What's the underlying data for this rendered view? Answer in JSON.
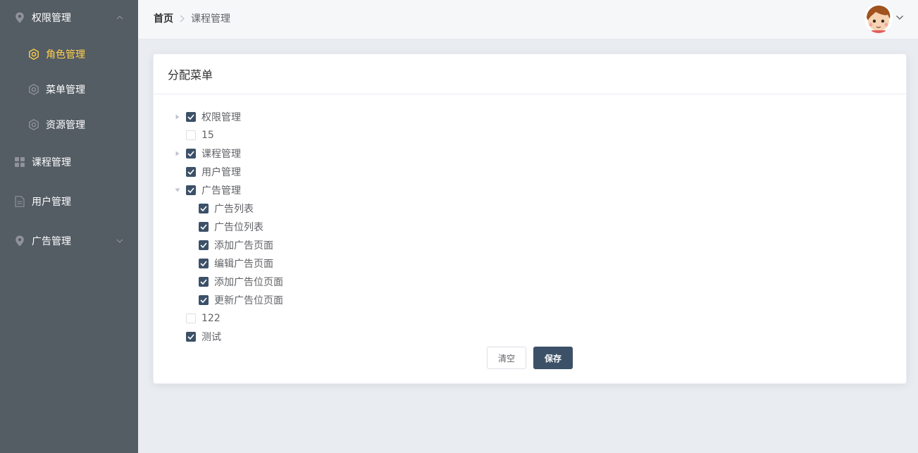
{
  "sidebar": {
    "items": [
      {
        "label": "权限管理",
        "icon": "location-icon"
      },
      {
        "label": "角色管理",
        "icon": "gear-icon"
      },
      {
        "label": "菜单管理",
        "icon": "gear-icon"
      },
      {
        "label": "资源管理",
        "icon": "gear-icon"
      },
      {
        "label": "课程管理",
        "icon": "grid-icon"
      },
      {
        "label": "用户管理",
        "icon": "document-icon"
      },
      {
        "label": "广告管理",
        "icon": "location-icon"
      }
    ]
  },
  "header": {
    "breadcrumb": {
      "home": "首页",
      "current": "课程管理"
    }
  },
  "card": {
    "title": "分配菜单",
    "tree": [
      {
        "label": "权限管理",
        "checked": true
      },
      {
        "label": "15",
        "checked": false
      },
      {
        "label": "课程管理",
        "checked": true
      },
      {
        "label": "用户管理",
        "checked": true
      },
      {
        "label": "广告管理",
        "checked": true
      },
      {
        "label": "广告列表",
        "checked": true
      },
      {
        "label": "广告位列表",
        "checked": true
      },
      {
        "label": "添加广告页面",
        "checked": true
      },
      {
        "label": "编辑广告页面",
        "checked": true
      },
      {
        "label": "添加广告位页面",
        "checked": true
      },
      {
        "label": "更新广告位页面",
        "checked": true
      },
      {
        "label": "122",
        "checked": false
      },
      {
        "label": "测试",
        "checked": true
      }
    ],
    "buttons": {
      "clear": "清空",
      "save": "保存"
    }
  },
  "colors": {
    "sidebar_bg": "#545c64",
    "active_text": "#ffd04b",
    "primary": "#3c5168"
  }
}
